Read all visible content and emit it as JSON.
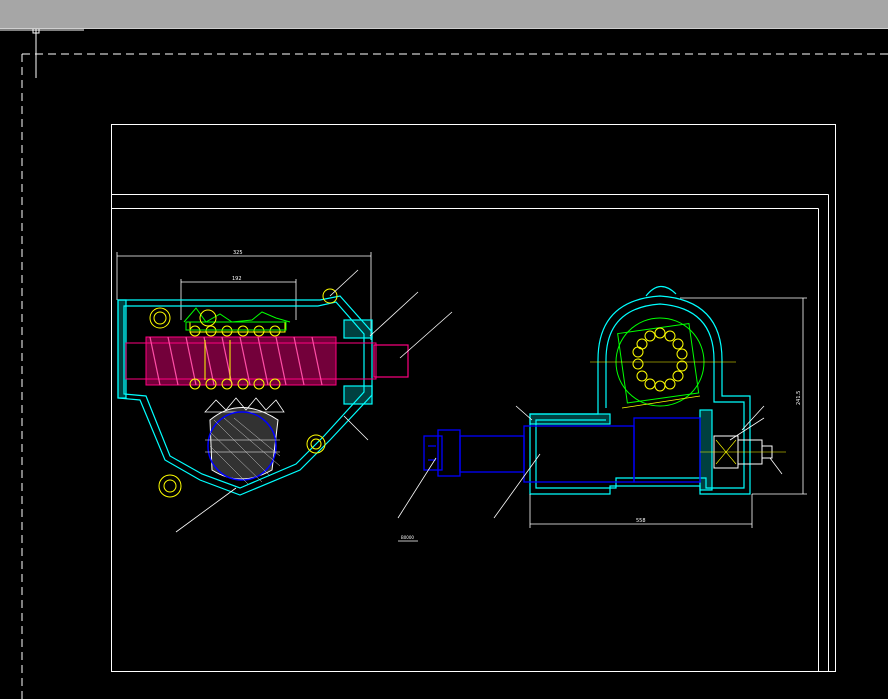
{
  "app": {
    "theme": {
      "model_space_bg": "#000000",
      "toolbar_bg": "#a6a6a6",
      "frame_color": "#ffffff",
      "housing_color": "#00ffff",
      "worm_color": "#ff0080",
      "bearing_color": "#ffff00",
      "gear_color": "#0000ff",
      "clip_color": "#00ff00",
      "leader_color": "#ffffff"
    }
  },
  "drawing": {
    "left_view": {
      "overall_dim": "325",
      "inner_dim": "192"
    },
    "right_view": {
      "length_dim": "558",
      "height_dim": "241.5"
    },
    "title_block_label": "B0000"
  }
}
